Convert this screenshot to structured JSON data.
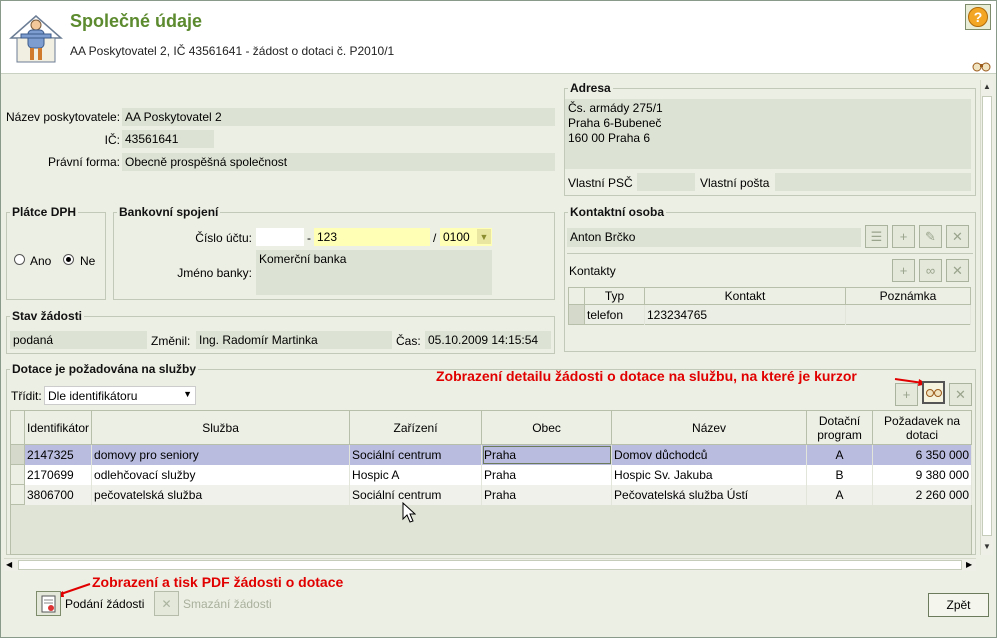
{
  "header": {
    "title": "Společné údaje",
    "subtitle": "AA Poskytovatel 2, IČ 43561641 - žádost o dotaci č. P2010/1",
    "help_symbol": "?"
  },
  "provider": {
    "name_label": "Název poskytovatele:",
    "name_value": "AA Poskytovatel 2",
    "ic_label": "IČ:",
    "ic_value": "43561641",
    "form_label": "Právní forma:",
    "form_value": "Obecně prospěšná společnost"
  },
  "address": {
    "title": "Adresa",
    "line1": "Čs. armády 275/1",
    "line2": "Praha 6-Bubeneč",
    "line3": "160 00  Praha 6",
    "own_psc_label": "Vlastní PSČ",
    "own_psc_value": "",
    "own_post_label": "Vlastní pošta",
    "own_post_value": ""
  },
  "vat": {
    "title": "Plátce DPH",
    "yes_label": "Ano",
    "no_label": "Ne",
    "selected": "Ne"
  },
  "bank": {
    "title": "Bankovní spojení",
    "account_label": "Číslo účtu:",
    "prefix_value": "",
    "dash": "-",
    "account_value": "123",
    "slash": "/",
    "bank_code_value": "0100",
    "bank_name_label": "Jméno banky:",
    "bank_name_value": "Komerční banka"
  },
  "contact": {
    "title": "Kontaktní osoba",
    "person_value": "Anton Brčko",
    "contacts_label": "Kontakty",
    "columns": [
      "Typ",
      "Kontakt",
      "Poznámka"
    ],
    "rows": [
      {
        "type": "telefon",
        "contact": "123234765",
        "note": ""
      }
    ]
  },
  "status": {
    "title": "Stav žádosti",
    "state_value": "podaná",
    "changed_label": "Změnil:",
    "changed_value": "Ing. Radomír Martinka",
    "time_label": "Čas:",
    "time_value": "05.10.2009 14:15:54"
  },
  "services": {
    "title": "Dotace je požadována na služby",
    "sort_label": "Třídit:",
    "sort_value": "Dle identifikátoru",
    "annotation": "Zobrazení detailu žádosti o dotace na službu, na které je kurzor",
    "columns": [
      "Identifikátor",
      "Služba",
      "Zařízení",
      "Obec",
      "Název",
      "Dotační program",
      "Požadavek na dotaci"
    ],
    "rows": [
      {
        "id": "2147325",
        "service": "domovy pro seniory",
        "facility": "Sociální centrum",
        "city": "Praha",
        "name": "Domov důchodců",
        "program": "A",
        "amount": "6 350 000"
      },
      {
        "id": "2170699",
        "service": "odlehčovací služby",
        "facility": "Hospic A",
        "city": "Praha",
        "name": "Hospic Sv. Jakuba",
        "program": "B",
        "amount": "9 380 000"
      },
      {
        "id": "3806700",
        "service": "pečovatelská služba",
        "facility": "Sociální centrum",
        "city": "Praha",
        "name": "Pečovatelská služba Ústí",
        "program": "A",
        "amount": "2 260 000"
      }
    ]
  },
  "footer": {
    "annotation": "Zobrazení a tisk PDF žádosti o dotace",
    "submit_label": "Podání žádosti",
    "delete_label": "Smazání žádosti",
    "back_label": "Zpět"
  },
  "colors": {
    "title_green": "#5c8a2e",
    "readonly_bg": "#dde3d4",
    "required_yellow": "#ffffb5",
    "annotation_red": "#e10000",
    "selected_row": "#b9bcdf"
  }
}
